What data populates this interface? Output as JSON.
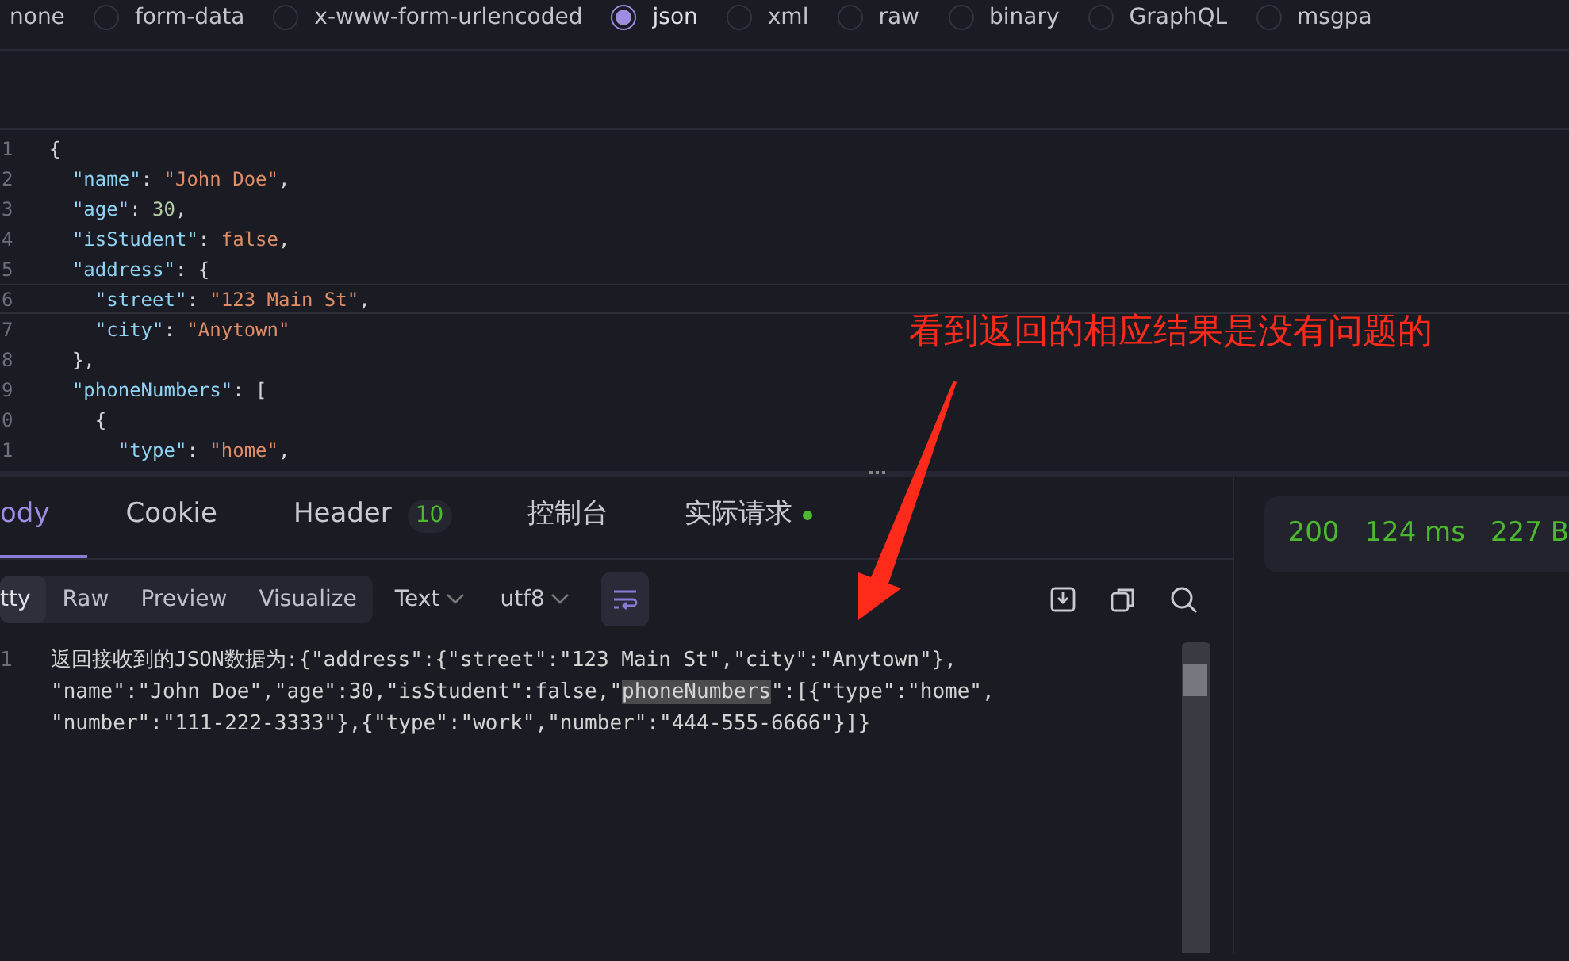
{
  "body_types": [
    {
      "label": "none",
      "selected": false,
      "kind": "plain"
    },
    {
      "label": "form-data",
      "selected": false,
      "kind": "radio"
    },
    {
      "label": "x-www-form-urlencoded",
      "selected": false,
      "kind": "radio"
    },
    {
      "label": "json",
      "selected": true,
      "kind": "radio"
    },
    {
      "label": "xml",
      "selected": false,
      "kind": "radio"
    },
    {
      "label": "raw",
      "selected": false,
      "kind": "radio"
    },
    {
      "label": "binary",
      "selected": false,
      "kind": "radio"
    },
    {
      "label": "GraphQL",
      "selected": false,
      "kind": "radio"
    },
    {
      "label": "msgpa",
      "selected": false,
      "kind": "radio"
    }
  ],
  "request_editor": {
    "lines": [
      {
        "number": "1",
        "current": false,
        "tokens": [
          {
            "kind": "punct",
            "text": "{"
          }
        ]
      },
      {
        "number": "2",
        "current": false,
        "tokens": [
          {
            "kind": "key",
            "text": "  \"name\""
          },
          {
            "kind": "punct",
            "text": ": "
          },
          {
            "kind": "string",
            "text": "\"John Doe\""
          },
          {
            "kind": "punct",
            "text": ","
          }
        ]
      },
      {
        "number": "3",
        "current": false,
        "tokens": [
          {
            "kind": "key",
            "text": "  \"age\""
          },
          {
            "kind": "punct",
            "text": ": "
          },
          {
            "kind": "number",
            "text": "30"
          },
          {
            "kind": "punct",
            "text": ","
          }
        ]
      },
      {
        "number": "4",
        "current": false,
        "tokens": [
          {
            "kind": "key",
            "text": "  \"isStudent\""
          },
          {
            "kind": "punct",
            "text": ": "
          },
          {
            "kind": "bool",
            "text": "false"
          },
          {
            "kind": "punct",
            "text": ","
          }
        ]
      },
      {
        "number": "5",
        "current": false,
        "tokens": [
          {
            "kind": "key",
            "text": "  \"address\""
          },
          {
            "kind": "punct",
            "text": ": {"
          }
        ]
      },
      {
        "number": "6",
        "current": true,
        "tokens": [
          {
            "kind": "key",
            "text": "    \"street\""
          },
          {
            "kind": "punct",
            "text": ": "
          },
          {
            "kind": "string",
            "text": "\"123 Main St\""
          },
          {
            "kind": "punct",
            "text": ","
          }
        ]
      },
      {
        "number": "7",
        "current": false,
        "tokens": [
          {
            "kind": "key",
            "text": "    \"city\""
          },
          {
            "kind": "punct",
            "text": ": "
          },
          {
            "kind": "string",
            "text": "\"Anytown\""
          }
        ]
      },
      {
        "number": "8",
        "current": false,
        "tokens": [
          {
            "kind": "punct",
            "text": "  },"
          }
        ]
      },
      {
        "number": "9",
        "current": false,
        "tokens": [
          {
            "kind": "key",
            "text": "  \"phoneNumbers\""
          },
          {
            "kind": "punct",
            "text": ": ["
          }
        ]
      },
      {
        "number": "0",
        "current": false,
        "tokens": [
          {
            "kind": "punct",
            "text": "    {"
          }
        ]
      },
      {
        "number": "1",
        "current": false,
        "tokens": [
          {
            "kind": "key",
            "text": "      \"type\""
          },
          {
            "kind": "punct",
            "text": ": "
          },
          {
            "kind": "string",
            "text": "\"home\""
          },
          {
            "kind": "punct",
            "text": ","
          }
        ]
      }
    ]
  },
  "response_tabs": [
    {
      "label": "ody",
      "selected": true
    },
    {
      "label": "Cookie",
      "selected": false
    },
    {
      "label": "Header",
      "selected": false,
      "badge": "10"
    },
    {
      "label": "控制台",
      "selected": false
    },
    {
      "label": "实际请求",
      "selected": false,
      "dot": true
    }
  ],
  "view_modes": [
    {
      "label": "tty",
      "selected": true
    },
    {
      "label": "Raw",
      "selected": false
    },
    {
      "label": "Preview",
      "selected": false
    },
    {
      "label": "Visualize",
      "selected": false
    }
  ],
  "format_dropdown": "Text",
  "encoding_dropdown": "utf8",
  "word_wrap": true,
  "response_body": {
    "line_number": "1",
    "rows": [
      [
        {
          "text": "返回接收到的JSON数据为:{\"address\":{\"street\":\"123 Main St\",\"city\":\"Anytown\"},",
          "highlighted": false
        }
      ],
      [
        {
          "text": "\"name\":\"John Doe\",\"age\":30,\"isStudent\":false,\"",
          "highlighted": false
        },
        {
          "text": "phoneNumbers",
          "highlighted": true
        },
        {
          "text": "\":[{\"type\":\"home\",",
          "highlighted": false
        }
      ],
      [
        {
          "text": "\"number\":\"111-222-3333\"},{\"type\":\"work\",\"number\":\"444-555-6666\"}]}",
          "highlighted": false
        }
      ]
    ]
  },
  "status": {
    "code": "200",
    "time": "124 ms",
    "size": "227 B"
  },
  "annotation": {
    "text": "看到返回的相应结果是没有问题的"
  }
}
